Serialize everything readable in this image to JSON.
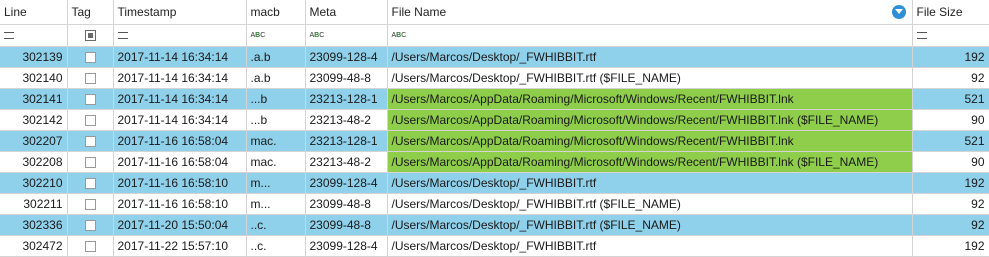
{
  "columns": {
    "line": "Line",
    "tag": "Tag",
    "timestamp": "Timestamp",
    "macb": "macb",
    "meta": "Meta",
    "file_name": "File Name",
    "file_size": "File Size"
  },
  "icons": {
    "filter": "filter-icon",
    "equals": "equals-filter-icon",
    "text_filter": "abc-filter-icon"
  },
  "colors": {
    "selected_row": "#8fd0ea",
    "highlight_cell": "#8fce4a"
  },
  "rows": [
    {
      "line": "302139",
      "timestamp": "2017-11-14 16:34:14",
      "macb": ".a.b",
      "meta": "23099-128-4",
      "file_name": "/Users/Marcos/Desktop/_FWHIBBIT.rtf",
      "file_size": "192",
      "selected": true,
      "highlight": false
    },
    {
      "line": "302140",
      "timestamp": "2017-11-14 16:34:14",
      "macb": ".a.b",
      "meta": "23099-48-8",
      "file_name": "/Users/Marcos/Desktop/_FWHIBBIT.rtf ($FILE_NAME)",
      "file_size": "92",
      "selected": false,
      "highlight": false
    },
    {
      "line": "302141",
      "timestamp": "2017-11-14 16:34:14",
      "macb": "...b",
      "meta": "23213-128-1",
      "file_name": "/Users/Marcos/AppData/Roaming/Microsoft/Windows/Recent/FWHIBBIT.lnk",
      "file_size": "521",
      "selected": true,
      "highlight": true
    },
    {
      "line": "302142",
      "timestamp": "2017-11-14 16:34:14",
      "macb": "...b",
      "meta": "23213-48-2",
      "file_name": "/Users/Marcos/AppData/Roaming/Microsoft/Windows/Recent/FWHIBBIT.lnk ($FILE_NAME)",
      "file_size": "90",
      "selected": false,
      "highlight": true
    },
    {
      "line": "302207",
      "timestamp": "2017-11-16 16:58:04",
      "macb": "mac.",
      "meta": "23213-128-1",
      "file_name": "/Users/Marcos/AppData/Roaming/Microsoft/Windows/Recent/FWHIBBIT.lnk",
      "file_size": "521",
      "selected": true,
      "highlight": true
    },
    {
      "line": "302208",
      "timestamp": "2017-11-16 16:58:04",
      "macb": "mac.",
      "meta": "23213-48-2",
      "file_name": "/Users/Marcos/AppData/Roaming/Microsoft/Windows/Recent/FWHIBBIT.lnk ($FILE_NAME)",
      "file_size": "90",
      "selected": false,
      "highlight": true
    },
    {
      "line": "302210",
      "timestamp": "2017-11-16 16:58:10",
      "macb": "m...",
      "meta": "23099-128-4",
      "file_name": "/Users/Marcos/Desktop/_FWHIBBIT.rtf",
      "file_size": "192",
      "selected": true,
      "highlight": false
    },
    {
      "line": "302211",
      "timestamp": "2017-11-16 16:58:10",
      "macb": "m...",
      "meta": "23099-48-8",
      "file_name": "/Users/Marcos/Desktop/_FWHIBBIT.rtf ($FILE_NAME)",
      "file_size": "92",
      "selected": false,
      "highlight": false
    },
    {
      "line": "302336",
      "timestamp": "2017-11-20 15:50:04",
      "macb": "..c.",
      "meta": "23099-48-8",
      "file_name": "/Users/Marcos/Desktop/_FWHIBBIT.rtf ($FILE_NAME)",
      "file_size": "92",
      "selected": true,
      "highlight": false
    },
    {
      "line": "302472",
      "timestamp": "2017-11-22 15:57:10",
      "macb": "..c.",
      "meta": "23099-128-4",
      "file_name": "/Users/Marcos/Desktop/_FWHIBBIT.rtf",
      "file_size": "192",
      "selected": false,
      "highlight": false
    }
  ]
}
